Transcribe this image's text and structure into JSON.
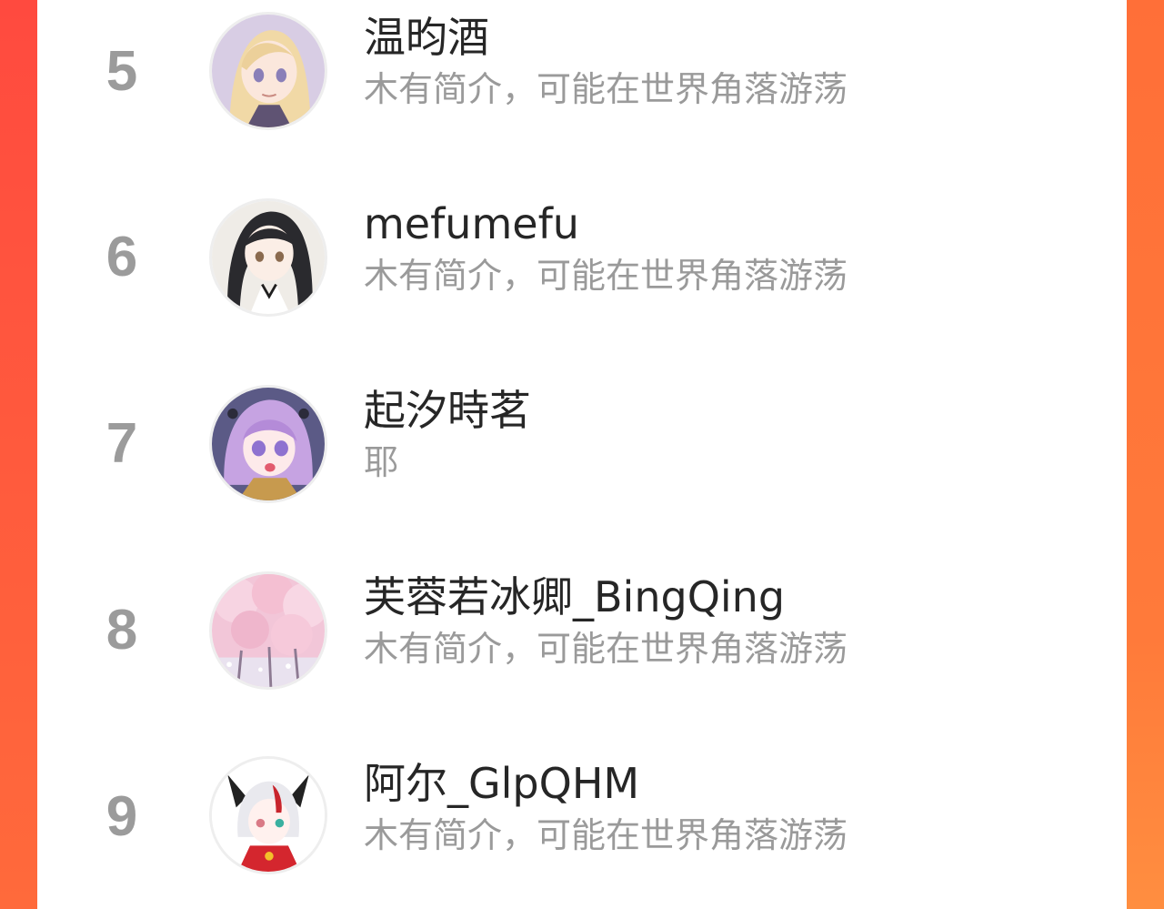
{
  "colors": {
    "accent": "#ff5a3d",
    "rank_text": "#9b9b9b",
    "name_text": "#262626",
    "bio_text": "#9a9a9a"
  },
  "ranking": {
    "items": [
      {
        "rank": "5",
        "name": "温昀酒",
        "bio": "木有简介，可能在世界角落游荡",
        "avatar_icon": "anime-avatar-blonde-girl-icon"
      },
      {
        "rank": "6",
        "name": "mefumefu",
        "bio": "木有简介，可能在世界角落游荡",
        "avatar_icon": "anime-avatar-black-hair-icon"
      },
      {
        "rank": "7",
        "name": "起汐時茗",
        "bio": "耶",
        "avatar_icon": "anime-avatar-purple-hair-icon"
      },
      {
        "rank": "8",
        "name": "芙蓉若冰卿_BingQing",
        "bio": "木有简介，可能在世界角落游荡",
        "avatar_icon": "cherry-blossom-avatar-icon"
      },
      {
        "rank": "9",
        "name": "阿尔_GlpQHM",
        "bio": "木有简介，可能在世界角落游荡",
        "avatar_icon": "anime-avatar-cat-ears-icon"
      }
    ]
  }
}
